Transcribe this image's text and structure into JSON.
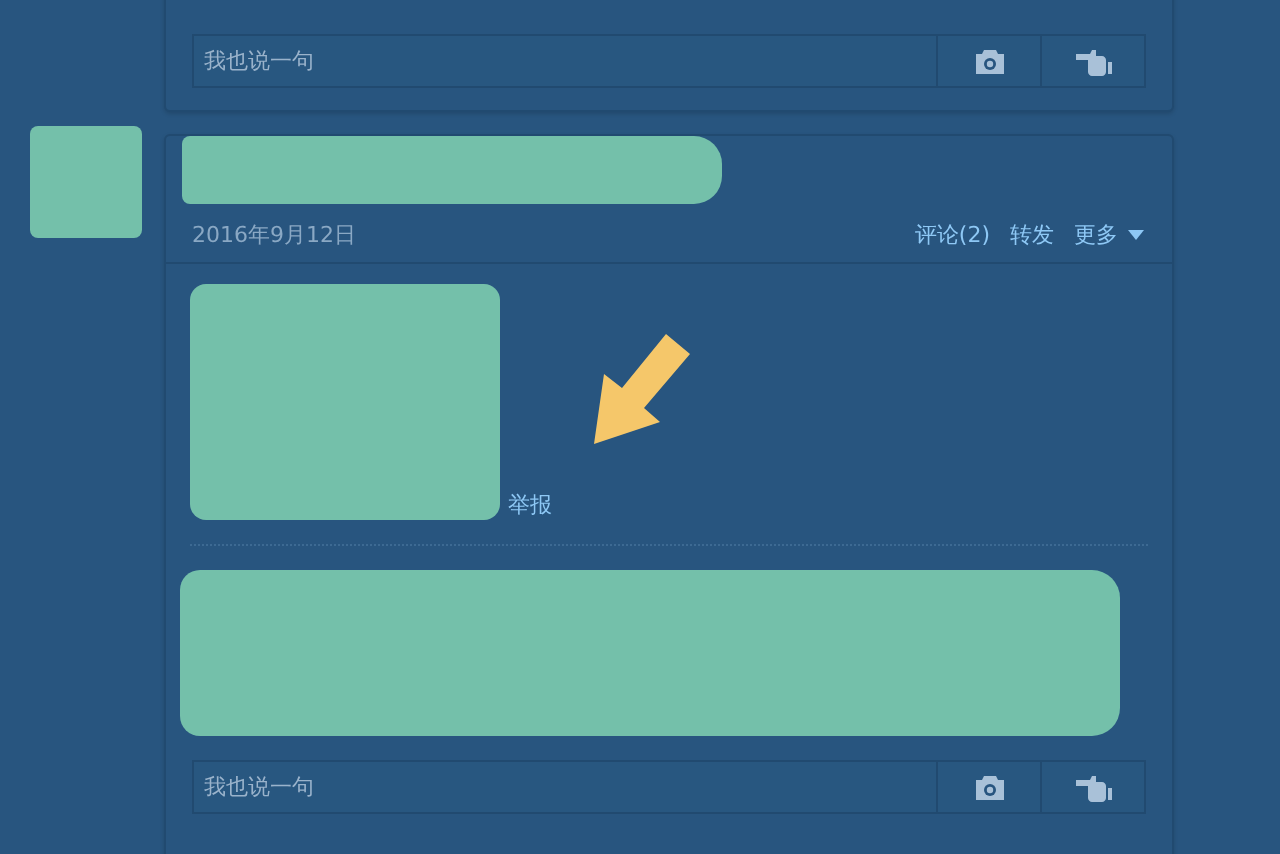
{
  "posts": [
    {
      "comment_box": {
        "placeholder": "我也说一句"
      }
    },
    {
      "date": "2016年9月12日",
      "actions": [
        {
          "label": "评论(2)"
        },
        {
          "label": "转发"
        },
        {
          "label": "更多",
          "kind": "dropdown"
        }
      ],
      "report_link": "举报",
      "comment_box": {
        "placeholder": "我也说一句"
      }
    }
  ]
}
